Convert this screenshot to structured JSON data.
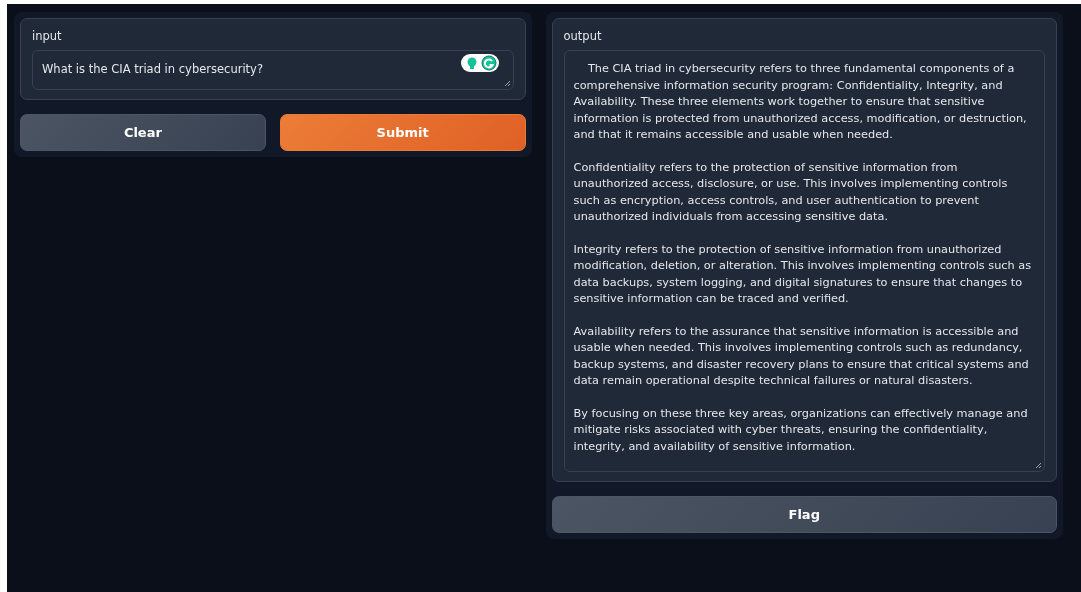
{
  "input_panel": {
    "label": "input",
    "value": "What is the CIA triad in cybersecurity?"
  },
  "buttons": [
    {
      "label": "Clear",
      "kind": "secondary"
    },
    {
      "label": "Submit",
      "kind": "primary"
    }
  ],
  "output_panel": {
    "label": "output",
    "paragraphs": [
      "    The CIA triad in cybersecurity refers to three fundamental components of a comprehensive information security program: Confidentiality, Integrity, and Availability. These three elements work together to ensure that sensitive information is protected from unauthorized access, modification, or destruction, and that it remains accessible and usable when needed.",
      "Confidentiality refers to the protection of sensitive information from unauthorized access, disclosure, or use. This involves implementing controls such as encryption, access controls, and user authentication to prevent unauthorized individuals from accessing sensitive data.",
      "Integrity refers to the protection of sensitive information from unauthorized modification, deletion, or alteration. This involves implementing controls such as data backups, system logging, and digital signatures to ensure that changes to sensitive information can be traced and verified.",
      "Availability refers to the assurance that sensitive information is accessible and usable when needed. This involves implementing controls such as redundancy, backup systems, and disaster recovery plans to ensure that critical systems and data remain operational despite technical failures or natural disasters.",
      "By focusing on these three key areas, organizations can effectively manage and mitigate risks associated with cyber threats, ensuring the confidentiality, integrity, and availability of sensitive information."
    ]
  },
  "flag_button": {
    "label": "Flag",
    "kind": "secondary"
  }
}
